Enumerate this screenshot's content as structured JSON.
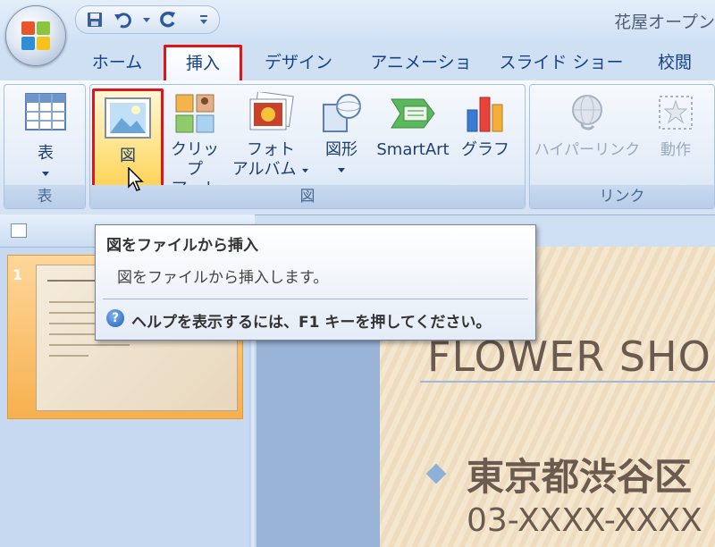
{
  "window": {
    "doc_title": "花屋オープン"
  },
  "tabs": [
    {
      "label": "ホーム"
    },
    {
      "label": "挿入"
    },
    {
      "label": "デザイン"
    },
    {
      "label": "アニメーション"
    },
    {
      "label": "スライド ショー"
    },
    {
      "label": "校閲"
    }
  ],
  "ribbon": {
    "groups": {
      "table": {
        "label": "表",
        "buttons": {
          "table": "表"
        }
      },
      "illustrations": {
        "label": "図",
        "buttons": {
          "picture": "図",
          "clipart_1": "クリップ",
          "clipart_2": "アート",
          "album_1": "フォト",
          "album_2": "アルバム",
          "shapes": "図形",
          "smartart": "SmartArt",
          "chart": "グラフ"
        }
      },
      "links": {
        "label": "リンク",
        "buttons": {
          "hyperlink": "ハイパーリンク",
          "action": "動作"
        }
      }
    }
  },
  "tooltip": {
    "title": "図をファイルから挿入",
    "description": "図をファイルから挿入します。",
    "help": "ヘルプを表示するには、F1 キーを押してください。",
    "help_icon": "?"
  },
  "slides_pane": {
    "slide_number": "1"
  },
  "slide": {
    "title": "FLOWER SHO",
    "bullet1": "東京都渋谷区",
    "line2": "03-XXXX-XXXX"
  },
  "colors": {
    "accent_highlight": "#e0151a",
    "ribbon_text": "#15428b"
  }
}
